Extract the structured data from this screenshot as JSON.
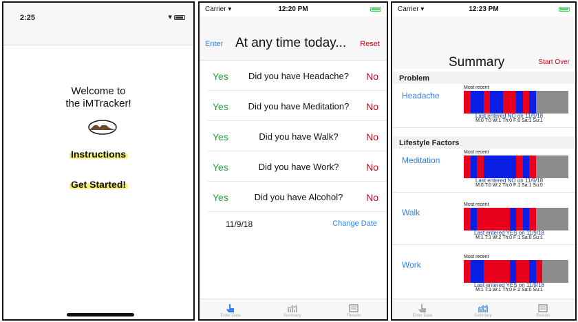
{
  "screen1": {
    "time": "2:25",
    "welcome_line1": "Welcome to",
    "welcome_line2": "the iMTracker!",
    "instructions": "Instructions",
    "get_started": "Get Started!"
  },
  "screen2": {
    "carrier": "Carrier",
    "time": "12:20 PM",
    "enter": "Enter",
    "title": "At any time today...",
    "reset": "Reset",
    "yes_label": "Yes",
    "no_label": "No",
    "questions": [
      "Did you have Headache?",
      "Did you have Meditation?",
      "Did you have Walk?",
      "Did you have Work?",
      "Did you have Alcohol?"
    ],
    "date": "11/9/18",
    "change_date": "Change Date",
    "tabs": [
      "Enter Data",
      "Summary",
      "Results"
    ]
  },
  "screen3": {
    "carrier": "Carrier",
    "time": "12:23 PM",
    "title": "Summary",
    "start_over": "Start Over",
    "section_problem": "Problem",
    "section_lifestyle": "Lifestyle Factors",
    "most_recent": "Most recent",
    "tabs": [
      "Enter Data",
      "Summary",
      "Results"
    ],
    "items": [
      {
        "name": "Headache",
        "last": "Last entered NO on 11/9/18",
        "week": "M:0 T:0 W:1 Th:0 F:0 Sa:1 Su:1",
        "bars": [
          "red",
          "blue",
          "blue",
          "red",
          "blue",
          "blue",
          "red",
          "red",
          "blue",
          "red",
          "blue",
          "gray",
          "gray",
          "gray",
          "gray",
          "gray"
        ]
      },
      {
        "name": "Meditation",
        "last": "Last entered NO on 11/9/18",
        "week": "M:0 T:0 W:2 Th:0 F:1 Sa:1 Su:0",
        "bars": [
          "red",
          "blue",
          "red",
          "blue",
          "blue",
          "blue",
          "blue",
          "blue",
          "red",
          "blue",
          "red",
          "gray",
          "gray",
          "gray",
          "gray",
          "gray"
        ]
      },
      {
        "name": "Walk",
        "last": "Last entered YES on 11/9/18",
        "week": "M:1 T:1 W:2 Th:0 F:1 Sa:0 Su:1",
        "bars": [
          "red",
          "blue",
          "red",
          "red",
          "red",
          "red",
          "red",
          "blue",
          "red",
          "blue",
          "red",
          "gray",
          "gray",
          "gray",
          "gray",
          "gray"
        ]
      },
      {
        "name": "Work",
        "last": "Last entered YES on 11/9/18",
        "week": "M:1 T:1 W:1 Th:0 F:2 Sa:0 Su:1",
        "bars": [
          "red",
          "blue",
          "blue",
          "red",
          "red",
          "red",
          "red",
          "blue",
          "red",
          "red",
          "blue",
          "red",
          "gray",
          "gray",
          "gray",
          "gray"
        ]
      }
    ]
  },
  "colors": {
    "red": "#e8001c",
    "blue": "#0a1fe6",
    "gray": "#8c8c8c",
    "accent": "#2f80ed"
  }
}
